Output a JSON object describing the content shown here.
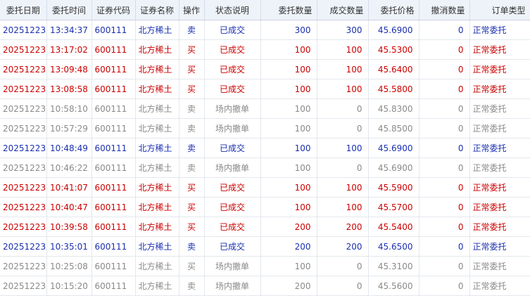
{
  "columns": [
    "委托日期",
    "委托时间",
    "证券代码",
    "证券名称",
    "操作",
    "状态说明",
    "委托数量",
    "成交数量",
    "委托价格",
    "撤消数量",
    "订单类型"
  ],
  "rows": [
    {
      "date": "20251223",
      "time": "13:34:37",
      "code": "600111",
      "name": "北方稀土",
      "op": "卖",
      "status": "已成交",
      "qty": "300",
      "filled": "300",
      "price": "45.6900",
      "cancelled": "0",
      "type": "正常委托",
      "kind": "sell"
    },
    {
      "date": "20251223",
      "time": "13:17:02",
      "code": "600111",
      "name": "北方稀土",
      "op": "买",
      "status": "已成交",
      "qty": "100",
      "filled": "100",
      "price": "45.5300",
      "cancelled": "0",
      "type": "正常委托",
      "kind": "buy"
    },
    {
      "date": "20251223",
      "time": "13:09:48",
      "code": "600111",
      "name": "北方稀土",
      "op": "买",
      "status": "已成交",
      "qty": "100",
      "filled": "100",
      "price": "45.6400",
      "cancelled": "0",
      "type": "正常委托",
      "kind": "buy"
    },
    {
      "date": "20251223",
      "time": "13:08:58",
      "code": "600111",
      "name": "北方稀土",
      "op": "买",
      "status": "已成交",
      "qty": "100",
      "filled": "100",
      "price": "45.5800",
      "cancelled": "0",
      "type": "正常委托",
      "kind": "buy"
    },
    {
      "date": "20251223",
      "time": "10:58:10",
      "code": "600111",
      "name": "北方稀土",
      "op": "卖",
      "status": "场内撤单",
      "qty": "100",
      "filled": "0",
      "price": "45.8300",
      "cancelled": "0",
      "type": "正常委托",
      "kind": "cancel"
    },
    {
      "date": "20251223",
      "time": "10:57:29",
      "code": "600111",
      "name": "北方稀土",
      "op": "卖",
      "status": "场内撤单",
      "qty": "100",
      "filled": "0",
      "price": "45.8500",
      "cancelled": "0",
      "type": "正常委托",
      "kind": "cancel"
    },
    {
      "date": "20251223",
      "time": "10:48:49",
      "code": "600111",
      "name": "北方稀土",
      "op": "卖",
      "status": "已成交",
      "qty": "100",
      "filled": "100",
      "price": "45.6900",
      "cancelled": "0",
      "type": "正常委托",
      "kind": "sell"
    },
    {
      "date": "20251223",
      "time": "10:46:22",
      "code": "600111",
      "name": "北方稀土",
      "op": "卖",
      "status": "场内撤单",
      "qty": "100",
      "filled": "0",
      "price": "45.6900",
      "cancelled": "0",
      "type": "正常委托",
      "kind": "cancel"
    },
    {
      "date": "20251223",
      "time": "10:41:07",
      "code": "600111",
      "name": "北方稀土",
      "op": "买",
      "status": "已成交",
      "qty": "100",
      "filled": "100",
      "price": "45.5900",
      "cancelled": "0",
      "type": "正常委托",
      "kind": "buy"
    },
    {
      "date": "20251223",
      "time": "10:40:47",
      "code": "600111",
      "name": "北方稀土",
      "op": "买",
      "status": "已成交",
      "qty": "100",
      "filled": "100",
      "price": "45.5700",
      "cancelled": "0",
      "type": "正常委托",
      "kind": "buy"
    },
    {
      "date": "20251223",
      "time": "10:39:58",
      "code": "600111",
      "name": "北方稀土",
      "op": "买",
      "status": "已成交",
      "qty": "200",
      "filled": "200",
      "price": "45.5400",
      "cancelled": "0",
      "type": "正常委托",
      "kind": "buy"
    },
    {
      "date": "20251223",
      "time": "10:35:01",
      "code": "600111",
      "name": "北方稀土",
      "op": "卖",
      "status": "已成交",
      "qty": "200",
      "filled": "200",
      "price": "45.6500",
      "cancelled": "0",
      "type": "正常委托",
      "kind": "sell"
    },
    {
      "date": "20251223",
      "time": "10:25:08",
      "code": "600111",
      "name": "北方稀土",
      "op": "买",
      "status": "场内撤单",
      "qty": "100",
      "filled": "0",
      "price": "45.3100",
      "cancelled": "0",
      "type": "正常委托",
      "kind": "cancel"
    },
    {
      "date": "20251223",
      "time": "10:15:20",
      "code": "600111",
      "name": "北方稀土",
      "op": "卖",
      "status": "场内撤单",
      "qty": "200",
      "filled": "0",
      "price": "45.5600",
      "cancelled": "0",
      "type": "正常委托",
      "kind": "cancel"
    }
  ]
}
